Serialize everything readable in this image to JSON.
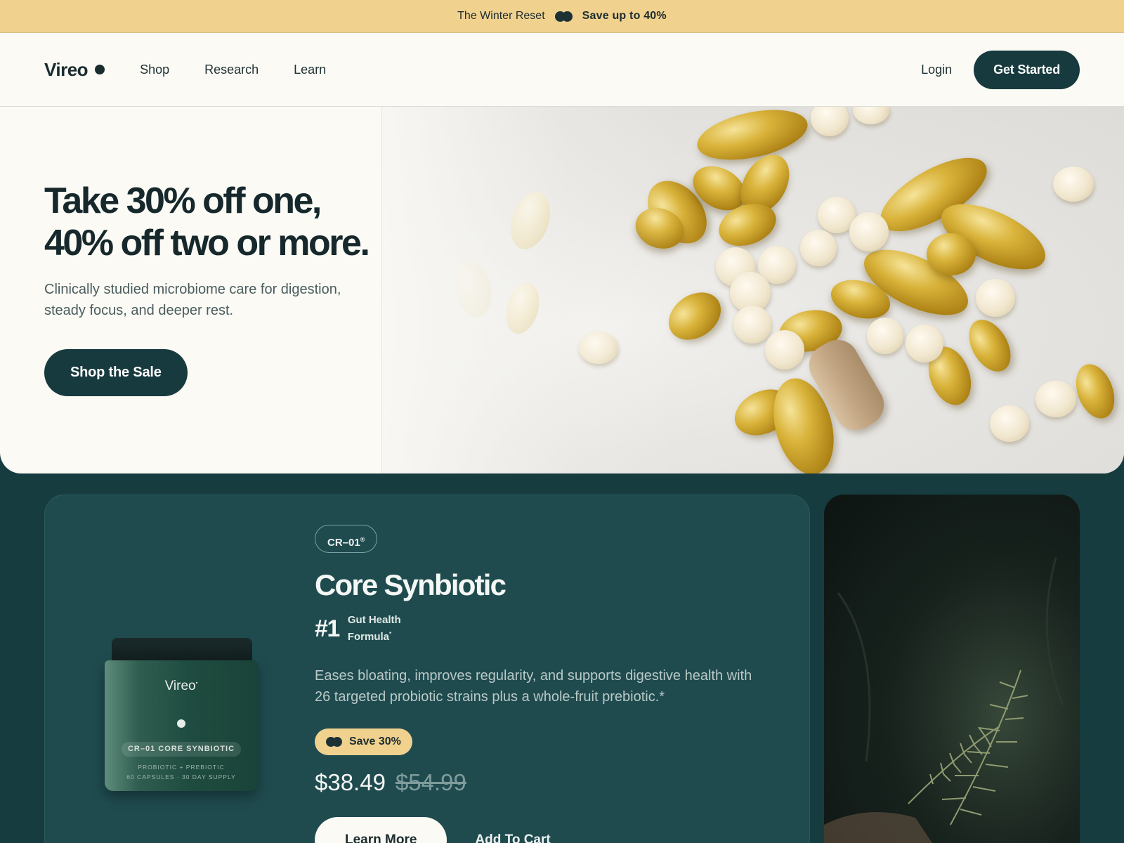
{
  "announcement": {
    "campaign": "The Winter Reset",
    "offer": "Save up to 40%"
  },
  "header": {
    "brand": "Vireo",
    "nav": [
      "Shop",
      "Research",
      "Learn"
    ],
    "login": "Login",
    "cta": "Get Started"
  },
  "hero": {
    "title_line1": "Take 30% off one,",
    "title_line2": "40% off two or more.",
    "subtitle": "Clinically studied microbiome care for digestion, steady focus, and deeper rest.",
    "cta": "Shop the Sale"
  },
  "product": {
    "tag": "CR–01",
    "tag_mark": "®",
    "name": "Core Synbiotic",
    "rank": "#1",
    "rank_line1": "Gut Health",
    "rank_line2": "Formula",
    "rank_mark": "*",
    "description": "Eases bloating, improves regularity, and supports digestive health with 26 targeted probiotic strains plus a whole-fruit prebiotic.*",
    "badge": "Save 30%",
    "price": "$38.49",
    "original_price": "$54.99",
    "learn_more": "Learn More",
    "add_to_cart": "Add To Cart",
    "jar": {
      "brand": "Vireo",
      "brand_mark": "•",
      "label": "CR–01 CORE SYNBIOTIC",
      "line1": "PROBIOTIC + PREBIOTIC",
      "line2": "60 CAPSULES · 30 DAY SUPPLY"
    }
  },
  "colors": {
    "announcement_bg": "#f0d18e",
    "page_bg": "#fbfaf5",
    "dark_teal": "#173a3e",
    "card_teal": "#1f4b4f"
  }
}
